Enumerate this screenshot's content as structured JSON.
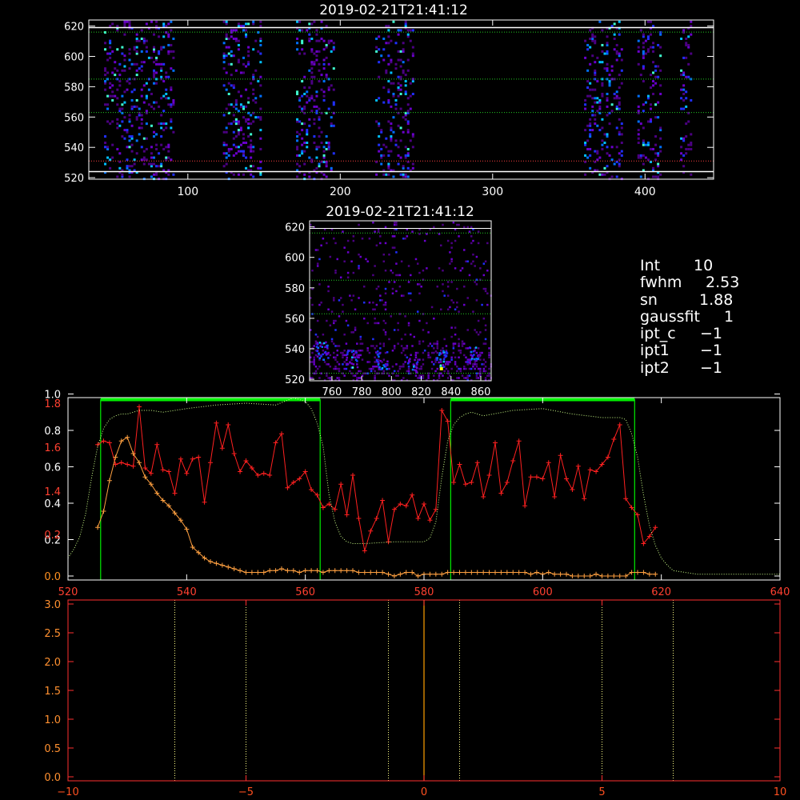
{
  "colors": {
    "background": "#000000",
    "frame": "#ffffff",
    "grid": "#22cc22",
    "red_series": "#ff2020",
    "orange_series": "#ffa040",
    "green_dotted": "#ccff88",
    "bars": "#00ee00",
    "bottom_axis": "#ff3030",
    "bottom_labels": "#ff5020",
    "center_line": "#ffa000",
    "dotted_vlines": "#ffff88"
  },
  "chart_data": [
    {
      "type": "heatmap",
      "title": "2019-02-21T21:41:12",
      "xlim": [
        35,
        445
      ],
      "ylim": [
        519,
        624
      ],
      "x_ticks": [
        "100",
        "200",
        "300",
        "400"
      ],
      "y_ticks": [
        "520",
        "540",
        "560",
        "580",
        "600",
        "620"
      ],
      "horizontal_lines": [
        524,
        616,
        585,
        563
      ],
      "red_line": 531,
      "white_lines": [
        619,
        524
      ],
      "column_bands": [
        [
          45,
          90
        ],
        [
          123,
          148
        ],
        [
          171,
          196
        ],
        [
          223,
          247
        ],
        [
          360,
          385
        ],
        [
          395,
          410
        ],
        [
          423,
          430
        ]
      ]
    },
    {
      "type": "heatmap",
      "title": "2019-02-21T21:41:12",
      "xlim": [
        745,
        867
      ],
      "ylim": [
        519,
        624
      ],
      "x_ticks": [
        "760",
        "780",
        "800",
        "820",
        "840",
        "860"
      ],
      "y_ticks": [
        "520",
        "540",
        "560",
        "580",
        "600",
        "620"
      ],
      "horizontal_lines": [
        524,
        616,
        585,
        563
      ],
      "hot_spots": [
        [
          753,
          538
        ],
        [
          773,
          533
        ],
        [
          793,
          532
        ],
        [
          813,
          530
        ],
        [
          833,
          533
        ],
        [
          855,
          535
        ]
      ]
    },
    {
      "type": "line",
      "xlim": [
        520,
        640
      ],
      "x_ticks": [
        "520",
        "540",
        "560",
        "580",
        "600",
        "620",
        "640"
      ],
      "left_ticks_white": [
        "0.0",
        "0.2",
        "0.4",
        "0.6",
        "0.8",
        "1.0"
      ],
      "left_ticks_red": [
        "0.2",
        "1.4",
        "1.6",
        "1.8"
      ],
      "vertical_lines": [
        525.5,
        562.5,
        584.5,
        615.5
      ],
      "bars": [
        [
          525.5,
          562.5
        ],
        [
          584.5,
          615.5
        ]
      ],
      "series": [
        {
          "role": "red",
          "x": [
            525,
            526,
            527,
            528,
            529,
            530,
            531,
            532,
            533,
            534,
            535,
            536,
            537,
            538,
            539,
            540,
            541,
            542,
            543,
            544,
            545,
            546,
            547,
            548,
            549,
            550,
            551,
            552,
            553,
            554,
            555,
            556,
            557,
            558,
            559,
            560,
            561,
            562,
            563,
            564,
            565,
            566,
            567,
            568,
            569,
            570,
            571,
            572,
            573,
            574,
            575,
            576,
            577,
            578,
            579,
            580,
            581,
            582,
            583,
            584,
            585,
            586,
            587,
            588,
            589,
            590,
            591,
            592,
            593,
            594,
            595,
            596,
            597,
            598,
            599,
            600,
            601,
            602,
            603,
            604,
            605,
            606,
            607,
            608,
            609,
            610,
            611,
            612,
            613,
            614,
            615,
            616,
            617,
            618,
            619
          ],
          "y": [
            0.73,
            0.75,
            0.74,
            0.62,
            0.63,
            0.62,
            0.61,
            0.94,
            0.6,
            0.57,
            0.73,
            0.59,
            0.58,
            0.46,
            0.65,
            0.57,
            0.65,
            0.66,
            0.41,
            0.63,
            0.85,
            0.71,
            0.84,
            0.68,
            0.58,
            0.64,
            0.6,
            0.56,
            0.57,
            0.56,
            0.74,
            0.79,
            0.49,
            0.52,
            0.54,
            0.58,
            0.48,
            0.45,
            0.38,
            0.4,
            0.37,
            0.51,
            0.34,
            0.56,
            0.32,
            0.14,
            0.25,
            0.32,
            0.42,
            0.19,
            0.37,
            0.4,
            0.39,
            0.45,
            0.32,
            0.4,
            0.31,
            0.37,
            0.92,
            0.86,
            0.52,
            0.62,
            0.51,
            0.52,
            0.63,
            0.44,
            0.56,
            0.74,
            0.46,
            0.52,
            0.64,
            0.75,
            0.39,
            0.55,
            0.55,
            0.54,
            0.63,
            0.44,
            0.67,
            0.54,
            0.48,
            0.61,
            0.43,
            0.59,
            0.58,
            0.62,
            0.66,
            0.76,
            0.84,
            0.43,
            0.38,
            0.34,
            0.18,
            0.22,
            0.27
          ]
        },
        {
          "role": "orange",
          "x": [
            525,
            526,
            527,
            528,
            529,
            530,
            531,
            532,
            533,
            534,
            535,
            536,
            537,
            538,
            539,
            540,
            541,
            542,
            543,
            544,
            545,
            546,
            547,
            548,
            549,
            550,
            551,
            552,
            553,
            554,
            555,
            556,
            557,
            558,
            559,
            560,
            561,
            562,
            563,
            564,
            565,
            566,
            567,
            568,
            569,
            570,
            571,
            572,
            573,
            574,
            575,
            576,
            577,
            578,
            579,
            580,
            581,
            582,
            583,
            584,
            585,
            586,
            587,
            588,
            589,
            590,
            591,
            592,
            593,
            594,
            595,
            596,
            597,
            598,
            599,
            600,
            601,
            602,
            603,
            604,
            605,
            606,
            607,
            608,
            609,
            610,
            611,
            612,
            613,
            614,
            615,
            616,
            617,
            618,
            619
          ],
          "y": [
            0.27,
            0.36,
            0.53,
            0.66,
            0.75,
            0.77,
            0.68,
            0.63,
            0.55,
            0.51,
            0.46,
            0.42,
            0.39,
            0.35,
            0.31,
            0.26,
            0.16,
            0.13,
            0.1,
            0.08,
            0.07,
            0.06,
            0.05,
            0.04,
            0.03,
            0.02,
            0.02,
            0.02,
            0.02,
            0.03,
            0.03,
            0.04,
            0.03,
            0.03,
            0.02,
            0.03,
            0.03,
            0.03,
            0.02,
            0.03,
            0.03,
            0.03,
            0.03,
            0.03,
            0.02,
            0.02,
            0.02,
            0.02,
            0.02,
            0.01,
            0.0,
            0.01,
            0.02,
            0.02,
            0.0,
            0.01,
            0.01,
            0.01,
            0.01,
            0.02,
            0.02,
            0.02,
            0.02,
            0.02,
            0.02,
            0.02,
            0.02,
            0.02,
            0.02,
            0.02,
            0.02,
            0.02,
            0.02,
            0.01,
            0.02,
            0.01,
            0.02,
            0.01,
            0.01,
            0.01,
            0.0,
            0.0,
            0.0,
            0.0,
            0.01,
            0.0,
            0.0,
            0.0,
            0.0,
            0.0,
            0.02,
            0.02,
            0.02,
            0.01,
            0.01
          ]
        },
        {
          "role": "green-dotted",
          "x": [
            520,
            521,
            522,
            523,
            524,
            525,
            526,
            527,
            528,
            529,
            530,
            532,
            534,
            536,
            540,
            545,
            550,
            555,
            558,
            560,
            561,
            562,
            563,
            564,
            565,
            566,
            567,
            568,
            570,
            575,
            580,
            581,
            582,
            583,
            584,
            585,
            586,
            587,
            588,
            590,
            595,
            600,
            605,
            610,
            612,
            613,
            614,
            615,
            616,
            617,
            618,
            619,
            620,
            621,
            622,
            624,
            626,
            630,
            635,
            640
          ],
          "y": [
            0.1,
            0.15,
            0.22,
            0.35,
            0.55,
            0.72,
            0.82,
            0.87,
            0.89,
            0.9,
            0.9,
            0.92,
            0.92,
            0.91,
            0.93,
            0.95,
            0.96,
            0.95,
            0.99,
            0.97,
            0.93,
            0.85,
            0.72,
            0.45,
            0.3,
            0.22,
            0.19,
            0.18,
            0.18,
            0.19,
            0.19,
            0.21,
            0.3,
            0.55,
            0.75,
            0.84,
            0.88,
            0.9,
            0.91,
            0.89,
            0.92,
            0.93,
            0.9,
            0.88,
            0.88,
            0.88,
            0.87,
            0.79,
            0.66,
            0.45,
            0.28,
            0.17,
            0.1,
            0.06,
            0.03,
            0.02,
            0.01,
            0.01,
            0.01,
            0.01
          ]
        }
      ]
    },
    {
      "type": "line",
      "xlim": [
        -10,
        10
      ],
      "ylim": [
        -0.1,
        3.0
      ],
      "x_ticks": [
        "−10",
        "−5",
        "0",
        "5",
        "10"
      ],
      "y_ticks": [
        "0.0",
        "0.5",
        "1.0",
        "1.5",
        "2.0",
        "2.5",
        "3.0"
      ],
      "dotted_vlines": [
        -7,
        -5,
        -1,
        1,
        5,
        7
      ],
      "center_line": 0
    }
  ],
  "info": {
    "rows": [
      {
        "key": "Int",
        "value": "10"
      },
      {
        "key": "fwhm",
        "value": "2.53"
      },
      {
        "key": "sn",
        "value": "1.88"
      },
      {
        "key": "gaussfit",
        "value": "1"
      },
      {
        "key": "ipt_c",
        "value": "−1"
      },
      {
        "key": "ipt1",
        "value": "−1"
      },
      {
        "key": "ipt2",
        "value": "−1"
      }
    ]
  }
}
